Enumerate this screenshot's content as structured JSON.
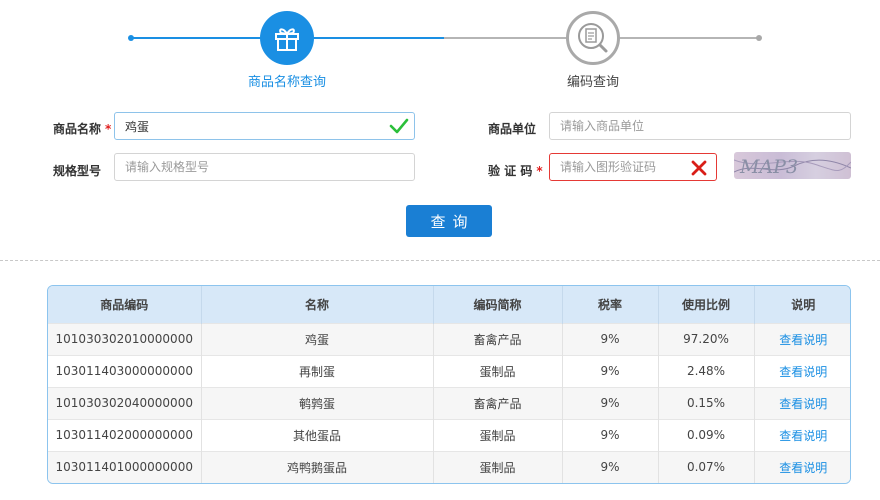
{
  "steps": [
    {
      "label": "商品名称查询",
      "icon": "gift-icon",
      "state": "active"
    },
    {
      "label": "编码查询",
      "icon": "document-search-icon",
      "state": "inactive"
    }
  ],
  "form": {
    "name": {
      "label": "商品名称",
      "required": "*",
      "value": "鸡蛋",
      "status": "valid"
    },
    "unit": {
      "label": "商品单位",
      "placeholder": "请输入商品单位"
    },
    "spec": {
      "label": "规格型号",
      "placeholder": "请输入规格型号"
    },
    "captcha": {
      "label": "验 证 码",
      "required": "*",
      "placeholder": "请输入图形验证码",
      "status": "invalid",
      "image_text": "MAP3"
    },
    "submit_label": "查询"
  },
  "table": {
    "columns": [
      "商品编码",
      "名称",
      "编码简称",
      "税率",
      "使用比例",
      "说明"
    ],
    "rows": [
      [
        "101030302010000000",
        "鸡蛋",
        "畜禽产品",
        "9%",
        "97.20%",
        "查看说明"
      ],
      [
        "103011403000000000",
        "再制蛋",
        "蛋制品",
        "9%",
        "2.48%",
        "查看说明"
      ],
      [
        "101030302040000000",
        "鹌鹑蛋",
        "畜禽产品",
        "9%",
        "0.15%",
        "查看说明"
      ],
      [
        "103011402000000000",
        "其他蛋品",
        "蛋制品",
        "9%",
        "0.09%",
        "查看说明"
      ],
      [
        "103011401000000000",
        "鸡鸭鹅蛋品",
        "蛋制品",
        "9%",
        "0.07%",
        "查看说明"
      ]
    ]
  },
  "colors": {
    "accent": "#1a8fe3",
    "button": "#1a7fd4",
    "valid": "#2bbf3a",
    "invalid": "#d91e18",
    "header_bg": "#d7e8f8"
  }
}
